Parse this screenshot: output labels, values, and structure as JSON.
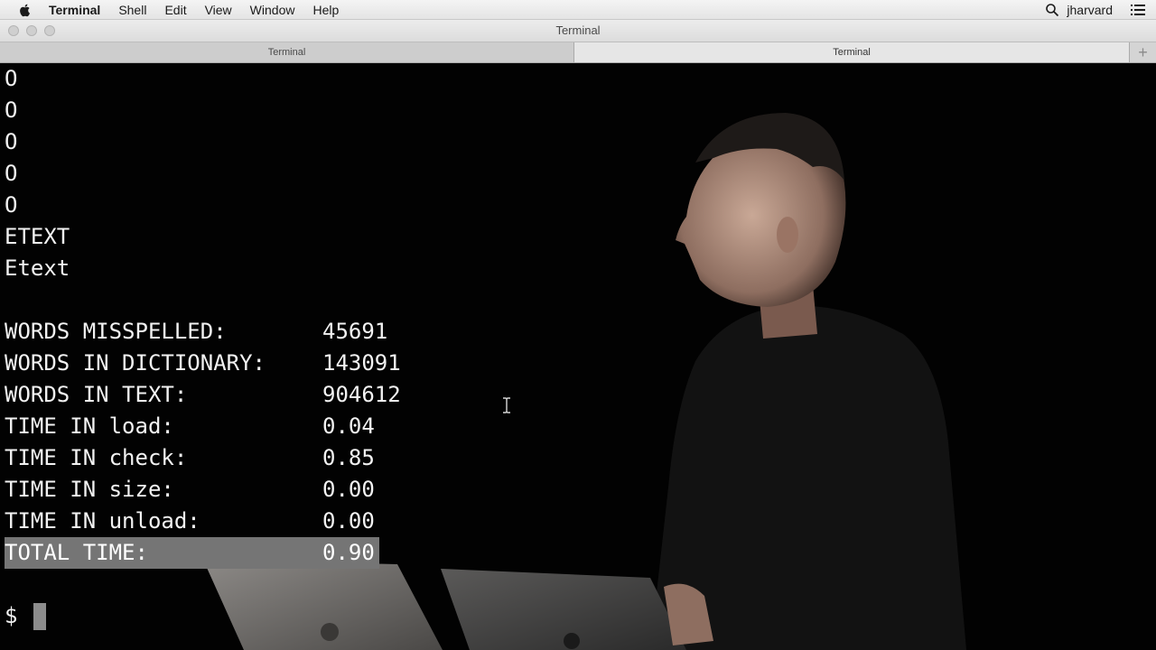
{
  "menubar": {
    "app_name": "Terminal",
    "items": [
      "Shell",
      "Edit",
      "View",
      "Window",
      "Help"
    ],
    "user": "jharvard"
  },
  "window": {
    "title": "Terminal"
  },
  "tabs": [
    {
      "label": "Terminal"
    },
    {
      "label": "Terminal"
    }
  ],
  "terminal": {
    "output_lines": [
      "O",
      "O",
      "O",
      "O",
      "O",
      "ETEXT",
      "Etext",
      ""
    ],
    "stats": [
      {
        "label": "WORDS MISSPELLED:",
        "value": "45691"
      },
      {
        "label": "WORDS IN DICTIONARY:",
        "value": "143091"
      },
      {
        "label": "WORDS IN TEXT:",
        "value": "904612"
      },
      {
        "label": "TIME IN load:",
        "value": "0.04"
      },
      {
        "label": "TIME IN check:",
        "value": "0.85"
      },
      {
        "label": "TIME IN size:",
        "value": "0.00"
      },
      {
        "label": "TIME IN unload:",
        "value": "0.00"
      },
      {
        "label": "TOTAL TIME:",
        "value": "0.90"
      }
    ],
    "prompt": "$"
  },
  "colors": {
    "terminal_bg": "#020202",
    "terminal_fg": "#f2f2f2",
    "selection": "#757575"
  }
}
